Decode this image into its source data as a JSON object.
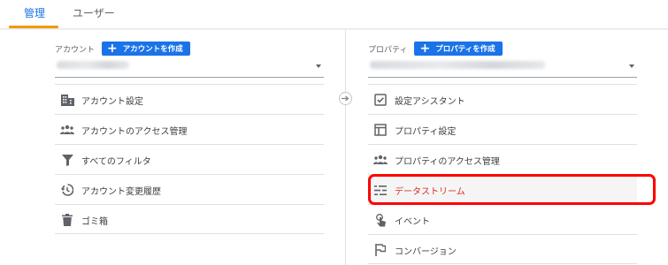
{
  "tabs": [
    {
      "label": "管理"
    },
    {
      "label": "ユーザー"
    }
  ],
  "account": {
    "label": "アカウント",
    "create_button": "アカウントを作成",
    "menu": [
      {
        "label": "アカウント設定",
        "icon": "building-icon"
      },
      {
        "label": "アカウントのアクセス管理",
        "icon": "people-icon"
      },
      {
        "label": "すべてのフィルタ",
        "icon": "filter-icon"
      },
      {
        "label": "アカウント変更履歴",
        "icon": "history-icon"
      },
      {
        "label": "ゴミ箱",
        "icon": "trash-icon"
      }
    ]
  },
  "property": {
    "label": "プロパティ",
    "create_button": "プロパティを作成",
    "menu": [
      {
        "label": "設定アシスタント",
        "icon": "checkbox-icon"
      },
      {
        "label": "プロパティ設定",
        "icon": "layout-icon"
      },
      {
        "label": "プロパティのアクセス管理",
        "icon": "people-icon"
      },
      {
        "label": "データストリーム",
        "icon": "streams-icon",
        "highlighted": true
      },
      {
        "label": "イベント",
        "icon": "touch-icon"
      },
      {
        "label": "コンバージョン",
        "icon": "flag-icon"
      }
    ]
  },
  "colors": {
    "accent": "#1a73e8",
    "tab_underline": "#f29900",
    "highlight_border": "#ff0000",
    "highlight_text": "#d93025"
  }
}
